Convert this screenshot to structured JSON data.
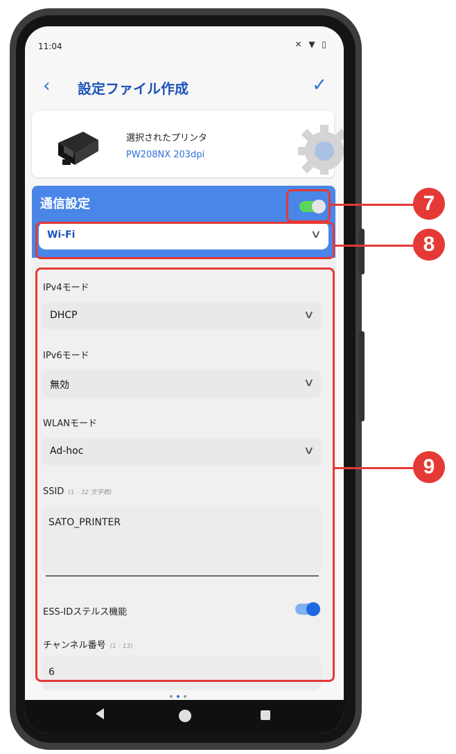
{
  "status_bar": {
    "time": "11:04",
    "icons": "✕ ▼ ▯"
  },
  "app_bar": {
    "back_icon": "chevron-left",
    "title": "設定ファイル作成",
    "confirm_icon": "check"
  },
  "printer": {
    "label": "選択されたプリンタ",
    "model": "PW208NX 203dpi"
  },
  "comm": {
    "title": "通信設定",
    "enabled": true,
    "interface": "Wi-Fi"
  },
  "fields": {
    "ipv4": {
      "label": "IPv4モード",
      "value": "DHCP"
    },
    "ipv6": {
      "label": "IPv6モード",
      "value": "無効"
    },
    "wlan": {
      "label": "WLANモード",
      "value": "Ad-hoc"
    },
    "ssid": {
      "label": "SSID",
      "hint": "(1 - 32 文字数)",
      "value": "SATO_PRINTER"
    },
    "stealth": {
      "label": "ESS-IDステルス機能",
      "enabled": true
    },
    "channel": {
      "label": "チャンネル番号",
      "hint": "(1 - 13)",
      "value": "6"
    }
  },
  "pager": {
    "count": 3,
    "active": 1
  },
  "callouts": [
    "7",
    "8",
    "9"
  ],
  "colors": {
    "accent": "#4a86e8",
    "title_blue": "#1d53b8",
    "callout": "#e53935",
    "toggle_green": "#5ad65a"
  }
}
